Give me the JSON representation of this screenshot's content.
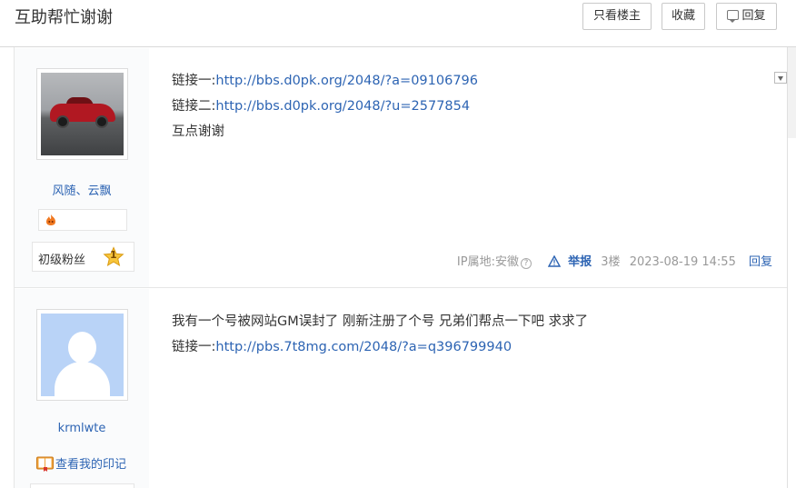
{
  "header": {
    "title": "互助帮忙谢谢",
    "only_op_label": "只看楼主",
    "favorite_label": "收藏",
    "reply_label": "回复"
  },
  "posts": [
    {
      "username": "风随、云飘",
      "level_title": "初级粉丝",
      "level_num": "1",
      "lines": [
        {
          "prefix": "链接一:",
          "link": "http://bbs.d0pk.org/2048/?a=09106796"
        },
        {
          "prefix": "链接二:",
          "link": "http://bbs.d0pk.org/2048/?u=2577854"
        },
        {
          "text": "互点谢谢"
        }
      ],
      "meta": {
        "ip_location": "IP属地:安徽",
        "report": "举报",
        "floor": "3楼",
        "time": "2023-08-19 14:55",
        "reply": "回复"
      }
    },
    {
      "username": "krmlwte",
      "impression": "查看我的印记",
      "lines": [
        {
          "text": "我有一个号被网站GM误封了 刚新注册了个号 兄弟们帮点一下吧 求求了"
        },
        {
          "prefix": "链接一:",
          "link": "http://pbs.7t8mg.com/2048/?a=q396799940"
        }
      ]
    }
  ],
  "colors": {
    "link": "#2d64b3",
    "meta_gray": "#999999",
    "sidebar_bg": "#fafbfc"
  }
}
